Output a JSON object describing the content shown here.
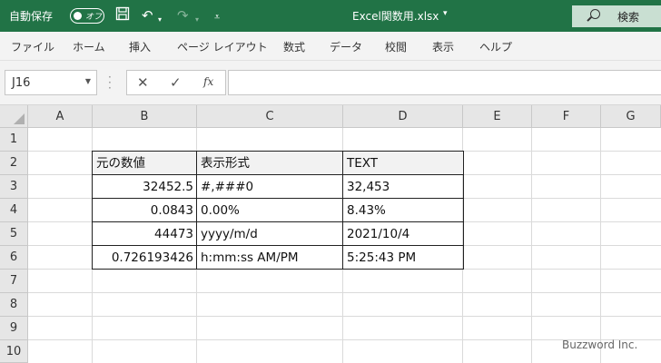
{
  "titlebar": {
    "autosave_label": "自動保存",
    "autosave_state": "オフ",
    "file_name": "Excel関数用.xlsx",
    "search_label": "検索"
  },
  "ribbon": {
    "tabs": [
      "ファイル",
      "ホーム",
      "挿入",
      "ページ レイアウト",
      "数式",
      "データ",
      "校閲",
      "表示",
      "ヘルプ"
    ]
  },
  "formula_bar": {
    "name_box": "J16",
    "fx_label": "fx",
    "formula": ""
  },
  "grid": {
    "columns": [
      "A",
      "B",
      "C",
      "D",
      "E",
      "F",
      "G"
    ],
    "rows": [
      "1",
      "2",
      "3",
      "4",
      "5",
      "6",
      "7",
      "8",
      "9",
      "10"
    ]
  },
  "table": {
    "headers": [
      "元の数値",
      "表示形式",
      "TEXT"
    ],
    "rows": [
      [
        "32452.5",
        "#,###0",
        "32,453"
      ],
      [
        "0.0843",
        "0.00%",
        "8.43%"
      ],
      [
        "44473",
        "yyyy/m/d",
        "2021/10/4"
      ],
      [
        "0.726193426",
        "h:mm:ss AM/PM",
        "5:25:43 PM"
      ]
    ]
  },
  "watermark": "Buzzword Inc.",
  "colors": {
    "title_bar": "#217346",
    "ribbon_bg": "#f3f3f3",
    "header_bg": "#e6e6e6",
    "table_header_fill": "#f2f2f2"
  }
}
